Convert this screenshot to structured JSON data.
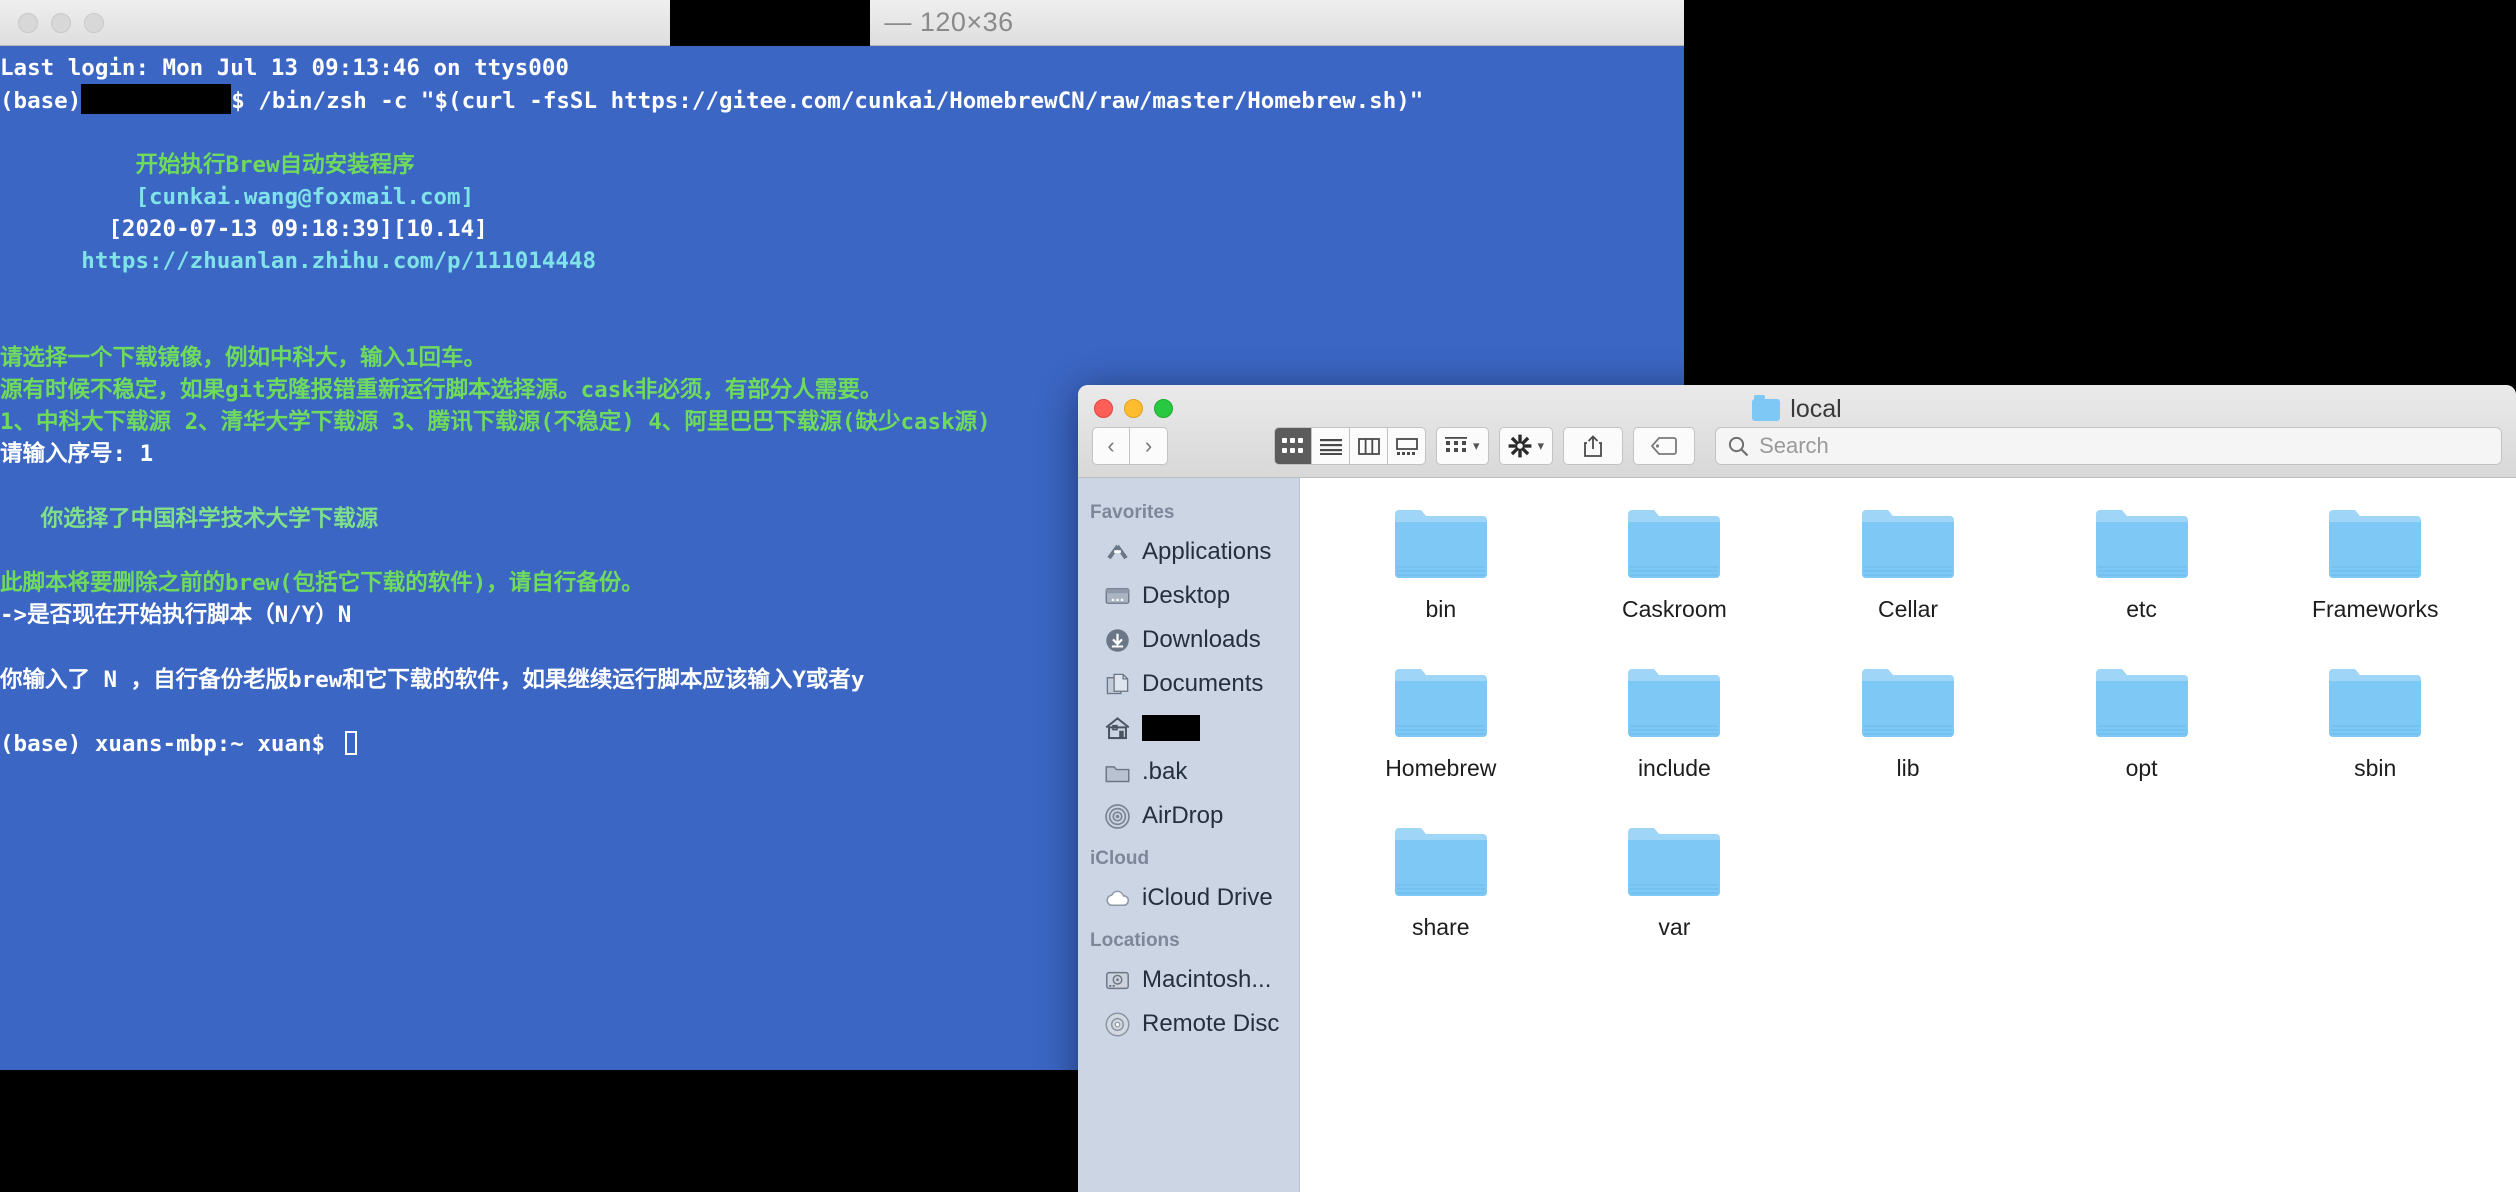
{
  "terminal": {
    "window_title_redacted": true,
    "dimensions_label": "— 120×36",
    "lines": [
      {
        "segments": [
          {
            "text": "Last login: Mon Jul 13 09:13:46 on ttys000",
            "color": "white"
          }
        ]
      },
      {
        "segments": [
          {
            "text": "(base)",
            "color": "white"
          },
          {
            "text": "",
            "color": "redact",
            "width": 150
          },
          {
            "text": "$ /bin/zsh -c \"$(curl -fsSL https://gitee.com/cunkai/HomebrewCN/raw/master/Homebrew.sh)\"",
            "color": "white"
          }
        ]
      },
      {
        "segments": [
          {
            "text": "",
            "color": "white"
          }
        ]
      },
      {
        "segments": [
          {
            "text": "          开始执行Brew自动安装程序",
            "color": "green"
          }
        ]
      },
      {
        "segments": [
          {
            "text": "          [cunkai.wang@foxmail.com]",
            "color": "cyan"
          }
        ]
      },
      {
        "segments": [
          {
            "text": "        [2020-07-13 09:18:39][10.14]",
            "color": "white"
          }
        ]
      },
      {
        "segments": [
          {
            "text": "      https://zhuanlan.zhihu.com/p/111014448",
            "color": "cyan"
          }
        ]
      },
      {
        "segments": [
          {
            "text": "",
            "color": "white"
          }
        ]
      },
      {
        "segments": [
          {
            "text": "",
            "color": "white"
          }
        ]
      },
      {
        "segments": [
          {
            "text": "请选择一个下载镜像，例如中科大，输入1回车。",
            "color": "green"
          }
        ]
      },
      {
        "segments": [
          {
            "text": "源有时候不稳定，如果git克隆报错重新运行脚本选择源。cask非必须，有部分人需要。",
            "color": "green"
          }
        ]
      },
      {
        "segments": [
          {
            "text": "1、中科大下载源 2、清华大学下载源 3、腾讯下载源(不稳定) 4、阿里巴巴下载源(缺少cask源)",
            "color": "green"
          }
        ]
      },
      {
        "segments": [
          {
            "text": "请输入序号: 1",
            "color": "white"
          }
        ]
      },
      {
        "segments": [
          {
            "text": "",
            "color": "white"
          }
        ]
      },
      {
        "segments": [
          {
            "text": "   你选择了中国科学技术大学下载源",
            "color": "lgreen"
          }
        ]
      },
      {
        "segments": [
          {
            "text": "",
            "color": "white"
          }
        ]
      },
      {
        "segments": [
          {
            "text": "此脚本将要删除之前的brew(包括它下载的软件)，请自行备份。",
            "color": "green"
          }
        ]
      },
      {
        "segments": [
          {
            "text": "->是否现在开始执行脚本（N/Y）N",
            "color": "white"
          }
        ]
      },
      {
        "segments": [
          {
            "text": "",
            "color": "white"
          }
        ]
      },
      {
        "segments": [
          {
            "text": "你输入了 N ，自行备份老版brew和它下载的软件，如果继续运行脚本应该输入Y或者y",
            "color": "white"
          }
        ]
      },
      {
        "segments": [
          {
            "text": "",
            "color": "white"
          }
        ]
      },
      {
        "segments": [
          {
            "text": "(base) xuans-mbp:~ xuan$ ",
            "color": "white",
            "cursor": true
          }
        ]
      }
    ]
  },
  "finder": {
    "title": "local",
    "traffic_lights": [
      "close",
      "minimize",
      "zoom"
    ],
    "nav": {
      "back": "‹",
      "forward": "›"
    },
    "view_modes": [
      {
        "name": "icon-view",
        "active": true
      },
      {
        "name": "list-view",
        "active": false
      },
      {
        "name": "column-view",
        "active": false
      },
      {
        "name": "gallery-view",
        "active": false
      }
    ],
    "arrange_button": "arrange-icon",
    "action_button": "gear-icon",
    "share_button": "share-icon",
    "tags_button": "tag-icon",
    "search": {
      "placeholder": "Search",
      "value": ""
    },
    "sidebar": {
      "sections": [
        {
          "header": "Favorites",
          "items": [
            {
              "label": "Applications",
              "icon": "applications-icon"
            },
            {
              "label": "Desktop",
              "icon": "desktop-icon"
            },
            {
              "label": "Downloads",
              "icon": "downloads-icon"
            },
            {
              "label": "Documents",
              "icon": "documents-icon"
            },
            {
              "label": "",
              "icon": "home-icon",
              "redacted": true
            },
            {
              "label": ".bak",
              "icon": "folder-icon"
            },
            {
              "label": "AirDrop",
              "icon": "airdrop-icon"
            }
          ]
        },
        {
          "header": "iCloud",
          "items": [
            {
              "label": "iCloud Drive",
              "icon": "cloud-icon"
            }
          ]
        },
        {
          "header": "Locations",
          "items": [
            {
              "label": "Macintosh...",
              "icon": "harddisk-icon"
            },
            {
              "label": "Remote Disc",
              "icon": "disc-icon"
            }
          ]
        }
      ]
    },
    "folders": [
      "bin",
      "Caskroom",
      "Cellar",
      "etc",
      "Frameworks",
      "Homebrew",
      "include",
      "lib",
      "opt",
      "sbin",
      "share",
      "var"
    ]
  },
  "colors": {
    "terminal_bg": "#3B66C4",
    "terminal_white": "#ffffff",
    "terminal_green": "#6FDB5C",
    "terminal_cyan": "#7FE3E8",
    "sidebar_bg": "#ccd5e4",
    "folder_blue": "#7ec8f5",
    "traffic_red": "#ff5f57",
    "traffic_yellow": "#febc2e",
    "traffic_green": "#28c840"
  }
}
